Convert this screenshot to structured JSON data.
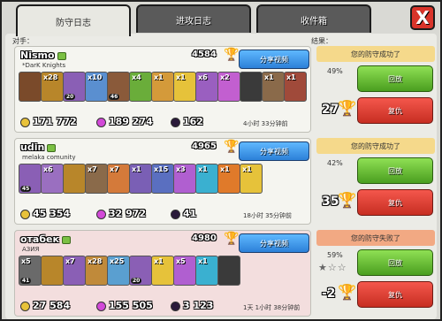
{
  "tabs": [
    {
      "label": "防守日志",
      "active": true
    },
    {
      "label": "进攻日志",
      "active": false
    },
    {
      "label": "收件箱",
      "active": false
    }
  ],
  "close_label": "X",
  "headers": {
    "opponent": "对手：",
    "result": "结果："
  },
  "entries": [
    {
      "name": "Nismo",
      "clan": "*DarK Knights",
      "trophies": "4584",
      "replay_label": "分享视频",
      "troops": [
        {
          "count": "",
          "level": "",
          "color": "#7a4a2a"
        },
        {
          "count": "x28",
          "level": "",
          "color": "#b8862a"
        },
        {
          "count": "",
          "level": "20",
          "color": "#8a5fb5"
        },
        {
          "count": "x10",
          "level": "",
          "color": "#5a8fd0"
        },
        {
          "count": "",
          "level": "46",
          "color": "#8a5a3a"
        },
        {
          "count": "x4",
          "level": "",
          "color": "#6aad3a"
        },
        {
          "count": "x1",
          "level": "",
          "color": "#d49a3a"
        },
        {
          "count": "x1",
          "level": "",
          "color": "#e6c23a"
        },
        {
          "count": "x6",
          "level": "",
          "color": "#9a5fc0"
        },
        {
          "count": "x2",
          "level": "",
          "color": "#c25fd0"
        },
        {
          "count": "",
          "level": "",
          "color": "#3a3a3a"
        },
        {
          "count": "x1",
          "level": "",
          "color": "#8a6a4a"
        },
        {
          "count": "x1",
          "level": "",
          "color": "#a04a3a"
        }
      ],
      "gold": "171 772",
      "elixir": "189 274",
      "dark_elixir": "162",
      "ago": "4小时 33分钟前",
      "result": {
        "banner": "您的防守成功了",
        "banner_type": "ok",
        "percent": "49%",
        "stars": "",
        "trophies": "27",
        "green_label": "回放",
        "red_label": "复仇"
      }
    },
    {
      "name": "udin",
      "clan": "melaka comunity",
      "trophies": "4965",
      "replay_label": "分享视频",
      "troops": [
        {
          "count": "",
          "level": "45",
          "color": "#8a5fb5"
        },
        {
          "count": "x6",
          "level": "",
          "color": "#9a6fc0"
        },
        {
          "count": "",
          "level": "",
          "color": "#b8862a"
        },
        {
          "count": "x7",
          "level": "",
          "color": "#8a6a4a"
        },
        {
          "count": "x7",
          "level": "",
          "color": "#d47a3a"
        },
        {
          "count": "x1",
          "level": "",
          "color": "#7a5fb5"
        },
        {
          "count": "x15",
          "level": "",
          "color": "#5a6fc0"
        },
        {
          "count": "x3",
          "level": "",
          "color": "#b05fd0"
        },
        {
          "count": "x1",
          "level": "",
          "color": "#3ab0d0"
        },
        {
          "count": "x1",
          "level": "",
          "color": "#e07a2a"
        },
        {
          "count": "x1",
          "level": "",
          "color": "#e6c23a"
        }
      ],
      "gold": "45 354",
      "elixir": "32 972",
      "dark_elixir": "41",
      "ago": "18小时 35分钟前",
      "result": {
        "banner": "您的防守成功了",
        "banner_type": "ok",
        "percent": "42%",
        "stars": "",
        "trophies": "35",
        "green_label": "回放",
        "red_label": "复仇"
      }
    },
    {
      "name": "отабек",
      "clan": "АЗИЯ",
      "trophies": "4980",
      "replay_label": "分享视频",
      "troops": [
        {
          "count": "x5",
          "level": "41",
          "color": "#6a6a6a"
        },
        {
          "count": "",
          "level": "",
          "color": "#b8862a"
        },
        {
          "count": "x7",
          "level": "",
          "color": "#8a5fb5"
        },
        {
          "count": "x28",
          "level": "",
          "color": "#c08a3a"
        },
        {
          "count": "x25",
          "level": "",
          "color": "#5a9fd0"
        },
        {
          "count": "",
          "level": "20",
          "color": "#8a5fb5"
        },
        {
          "count": "x1",
          "level": "",
          "color": "#e6c23a"
        },
        {
          "count": "x5",
          "level": "",
          "color": "#b05fd0"
        },
        {
          "count": "x1",
          "level": "",
          "color": "#3ab0d0"
        },
        {
          "count": "",
          "level": "",
          "color": "#3a3a3a"
        }
      ],
      "gold": "27 584",
      "elixir": "155 505",
      "dark_elixir": "3 123",
      "ago": "1天 1小时 38分钟前",
      "result": {
        "banner": "您的防守失败了",
        "banner_type": "fail",
        "percent": "59%",
        "stars": "★☆☆",
        "trophies": "-2",
        "green_label": "回放",
        "red_label": "复仇"
      }
    }
  ],
  "colors": {
    "gold": "#e8c23a",
    "elixir": "#d24ad8",
    "dark_elixir": "#2a1a3a"
  }
}
